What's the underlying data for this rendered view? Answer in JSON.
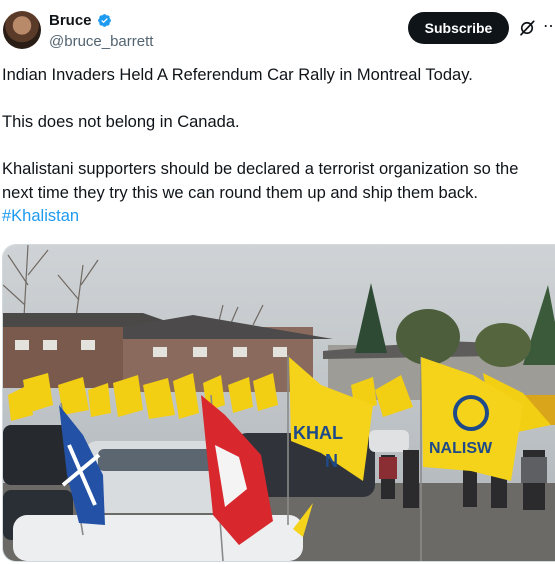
{
  "author": {
    "name": "Bruce",
    "handle": "@bruce_barrett",
    "verified": true,
    "avatar_icon": "profile-avatar"
  },
  "actions": {
    "subscribe_label": "Subscribe",
    "grok_icon": "grok-icon",
    "more_icon": "more-icon"
  },
  "tweet": {
    "line1": "Indian Invaders Held A Referendum Car Rally in Montreal Today.",
    "line2": "This does not belong in Canada.",
    "line3": "Khalistani supporters should be declared a terrorist organization so the next time they try this we can round them up and ship them back.",
    "hashtag": "#Khalistan"
  },
  "media": {
    "flag_text_1": "KHAL",
    "flag_text_1b": "N",
    "flag_text_2": "NALISW"
  },
  "colors": {
    "accent": "#1d9bf0",
    "verified": "#1d9bf0",
    "button_bg": "#0f1419",
    "flag_yellow": "#f5d31a"
  }
}
